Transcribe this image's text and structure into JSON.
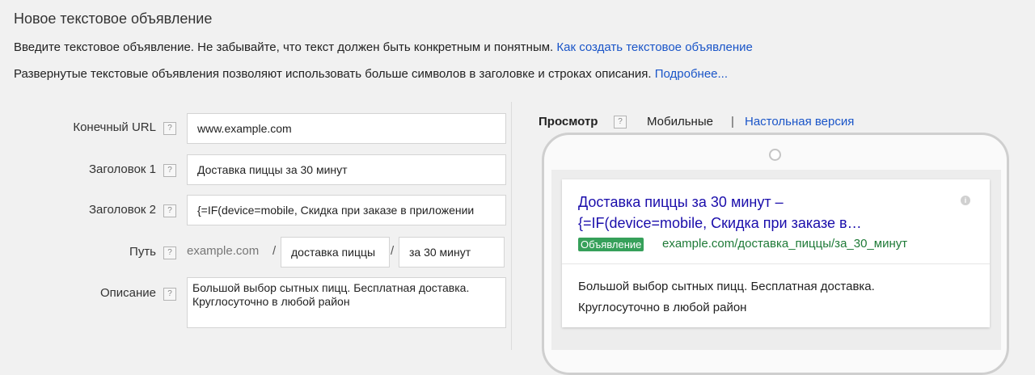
{
  "header": {
    "title": "Новое текстовое объявление",
    "intro_line1": "Введите текстовое объявление. Не забывайте, что текст должен быть конкретным и понятным.",
    "intro_link1": "Как создать текстовое объявление",
    "intro_line2": "Развернутые текстовые объявления позволяют использовать больше символов в заголовке и строках описания.",
    "intro_link2": "Подробнее..."
  },
  "form": {
    "help_glyph": "?",
    "final_url": {
      "label": "Конечный URL",
      "value": "www.example.com"
    },
    "headline1": {
      "label": "Заголовок 1",
      "value": "Доставка пиццы за 30 минут"
    },
    "headline2": {
      "label": "Заголовок 2",
      "value": "{=IF(device=mobile, Скидка при заказе в приложении"
    },
    "path": {
      "label": "Путь",
      "domain": "example.com",
      "separator": "/",
      "path1": "доставка пиццы",
      "path2": "за 30 минут"
    },
    "description": {
      "label": "Описание",
      "line1": "Большой выбор сытных пицц. Бесплатная доставка.",
      "line2": "Круглосуточно в любой район"
    }
  },
  "preview": {
    "title": "Просмотр",
    "mobile_tab": "Мобильные",
    "separator": "|",
    "desktop_tab": "Настольная версия",
    "ad": {
      "headline_line1": "Доставка пиццы за 30 минут –",
      "headline_line2": "{=IF(device=mobile, Скидка при заказе в…",
      "info_glyph": "i",
      "badge": "Объявление",
      "display_url": "example.com/доставка_пиццы/за_30_минут",
      "description_line1": "Большой выбор сытных пицц. Бесплатная доставка.",
      "description_line2": "Круглосуточно в любой район"
    }
  },
  "colors": {
    "link": "#1a55c8",
    "ad_headline": "#1a0dab",
    "ad_badge": "#36a05a",
    "ad_url": "#1e7a37"
  }
}
